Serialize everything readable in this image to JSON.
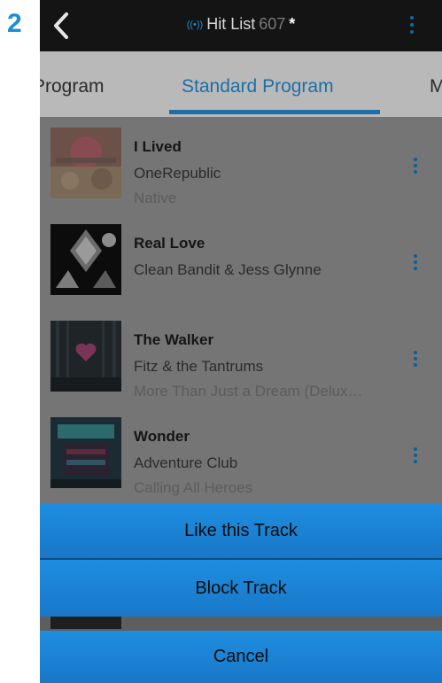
{
  "step_label": "2",
  "header": {
    "title": "Hit List",
    "count": "607",
    "modified_mark": "*",
    "broadcast_icon": "((•))"
  },
  "tabs": [
    {
      "label": "Program"
    },
    {
      "label": "Standard Program",
      "active": true
    },
    {
      "label": "M"
    }
  ],
  "tracks": [
    {
      "title": "I Lived",
      "artist": "OneRepublic",
      "album": "Native"
    },
    {
      "title": "Real Love",
      "artist": "Clean Bandit & Jess Glynne",
      "album": ""
    },
    {
      "title": "The Walker",
      "artist": "Fitz & the Tantrums",
      "album": "More Than Just a Dream (Delux…"
    },
    {
      "title": "Wonder",
      "artist": "Adventure Club",
      "album": "Calling All Heroes"
    }
  ],
  "action_sheet": {
    "like_label": "Like this Track",
    "block_label": "Block Track",
    "cancel_label": "Cancel"
  },
  "colors": {
    "accent": "#1a8fd6",
    "sheet_button": "#1e88d8",
    "topbar": "#141414"
  }
}
